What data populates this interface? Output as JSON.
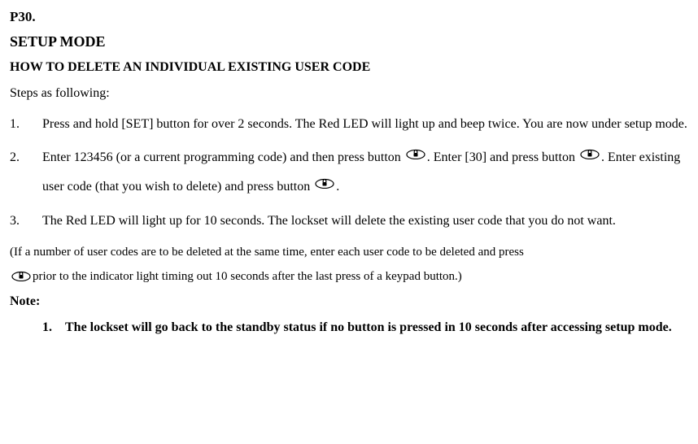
{
  "page_number": "P30.",
  "title": "SETUP MODE",
  "subtitle": "HOW TO DELETE AN INDIVIDUAL EXISTING USER CODE",
  "steps_intro": "Steps as following:",
  "steps": [
    {
      "num": "1.",
      "text": "Press and hold [SET] button for over 2 seconds. The Red LED will light up and beep twice. You are now under setup mode."
    },
    {
      "num": "2.",
      "text_a": "Enter 123456 (or a current programming code) and then press button ",
      "text_b": ". Enter [30] and press button ",
      "text_c": ". Enter existing user code (that you wish to delete) and press button ",
      "text_d": "."
    },
    {
      "num": "3.",
      "text": "The Red LED will light up for 10 seconds. The lockset will delete the existing user code that you do not want."
    }
  ],
  "batch_note_a": "(If a number of user codes are to be deleted at the same time, enter each user code to be deleted and press",
  "batch_note_b": "prior to the indicator light timing out 10 seconds after the last press of a keypad button.)",
  "note_label": "Note:",
  "notes": [
    {
      "num": "1.",
      "text": "The lockset will go back to the standby status if no button is pressed in 10 seconds after accessing setup mode."
    }
  ]
}
